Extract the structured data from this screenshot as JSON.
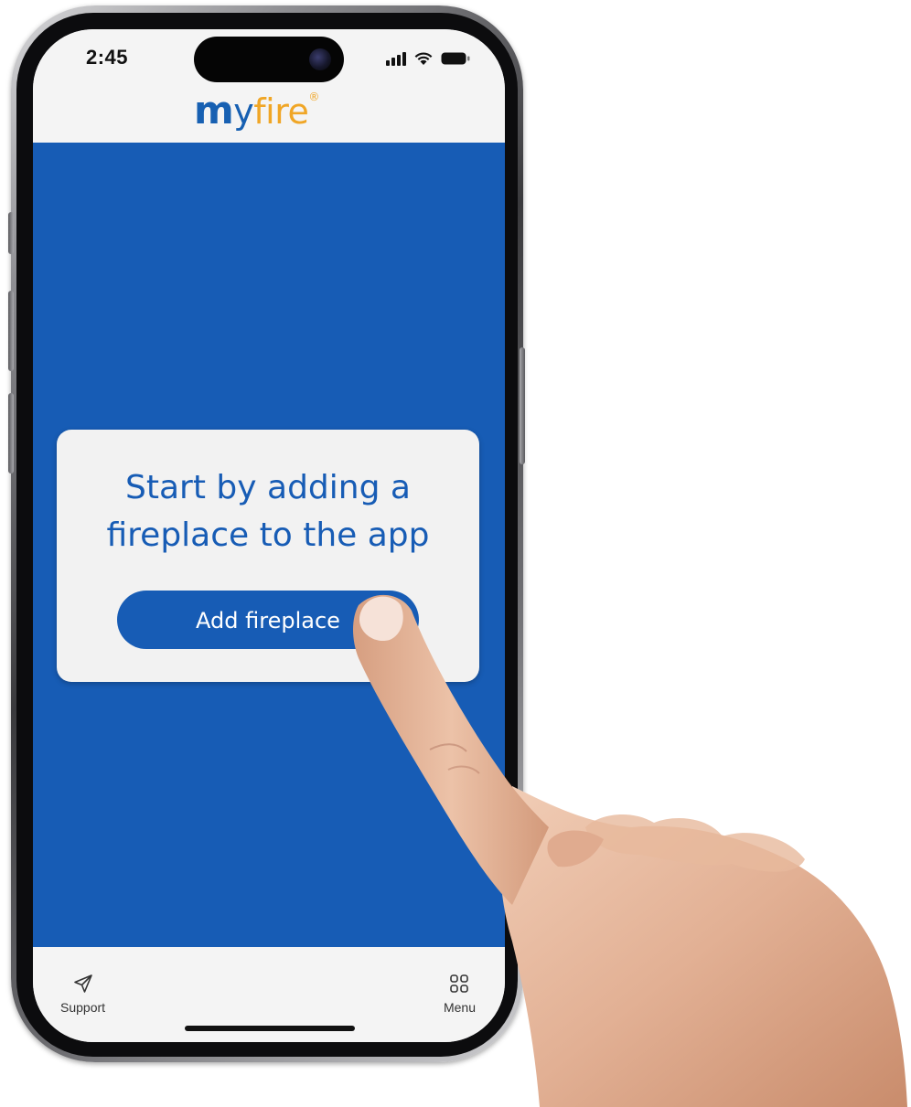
{
  "status_bar": {
    "time": "2:45",
    "icons": [
      "cellular-signal-icon",
      "wifi-icon",
      "battery-icon"
    ]
  },
  "header": {
    "logo_part_m": "m",
    "logo_part_y": "y",
    "logo_part_fire": "fire",
    "logo_registered": "®"
  },
  "card": {
    "title_line1": "Start by adding a",
    "title_line2": "fireplace to the app",
    "button_label": "Add fireplace"
  },
  "bottom_nav": {
    "items": [
      {
        "label": "Support",
        "icon": "send-icon"
      },
      {
        "label": "Menu",
        "icon": "grid-menu-icon"
      }
    ]
  },
  "colors": {
    "brand_blue": "#175cb5",
    "brand_orange": "#f0a626",
    "surface": "#f3f3f3"
  }
}
